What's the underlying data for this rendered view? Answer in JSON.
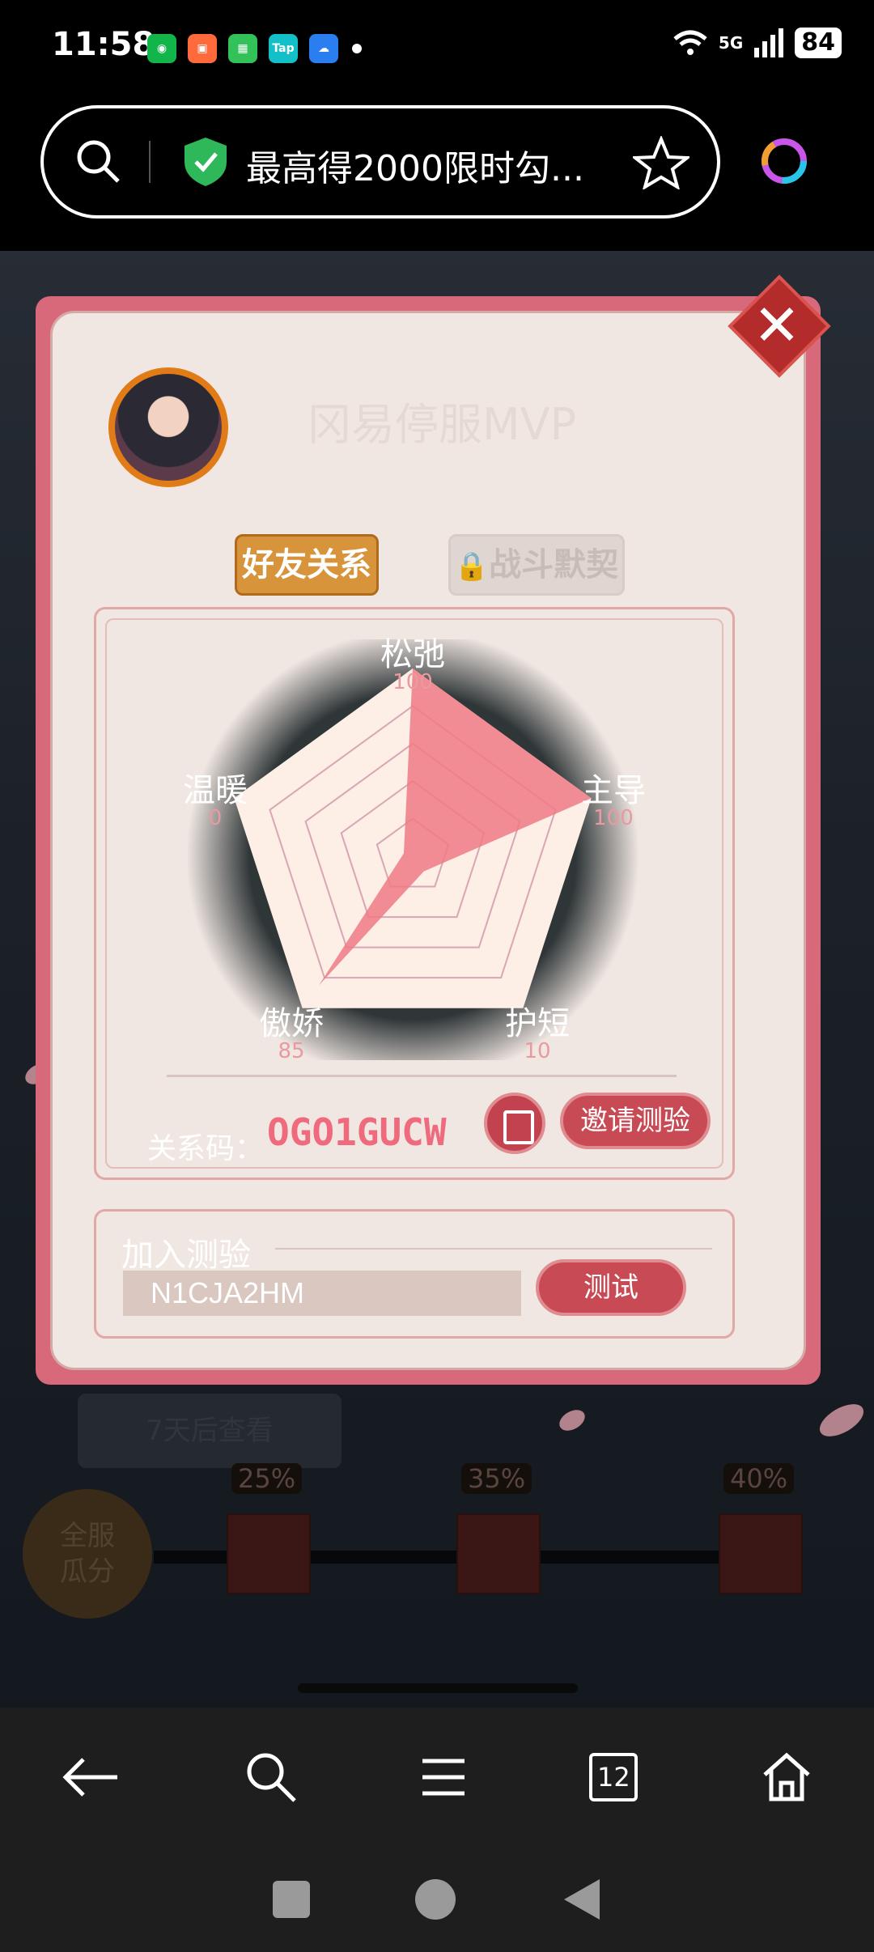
{
  "status_bar": {
    "time": "11:58",
    "network": "5G",
    "battery": "84"
  },
  "browser": {
    "url_title": "最高得2000限时勾...",
    "tab_count": "12"
  },
  "modal": {
    "server_name": "冈易停服MVP",
    "tabs": [
      {
        "label": "好友关系",
        "active": true
      },
      {
        "label": "战斗默契",
        "locked": true
      }
    ],
    "radar": {
      "axes": [
        {
          "label": "松弛",
          "value": 100
        },
        {
          "label": "主导",
          "value": 100
        },
        {
          "label": "护短",
          "value": 10
        },
        {
          "label": "傲娇",
          "value": 85
        },
        {
          "label": "温暖",
          "value": 0
        }
      ],
      "max": 100,
      "fill_color": "#f07a85"
    },
    "relation_code_label": "关系码：",
    "relation_code": "OGO1GUCW",
    "invite_label": "邀请测验",
    "join": {
      "title": "加入测验",
      "input_value": "N1CJA2HM",
      "test_label": "测试"
    }
  },
  "background": {
    "button_faded": "7天后查看",
    "all_server_label": "全服\n瓜分",
    "milestones": [
      "25%",
      "35%",
      "40%"
    ]
  },
  "colors": {
    "accent": "#c84a54",
    "modal_border": "#d7697a",
    "tab_active": "#d8943a"
  }
}
